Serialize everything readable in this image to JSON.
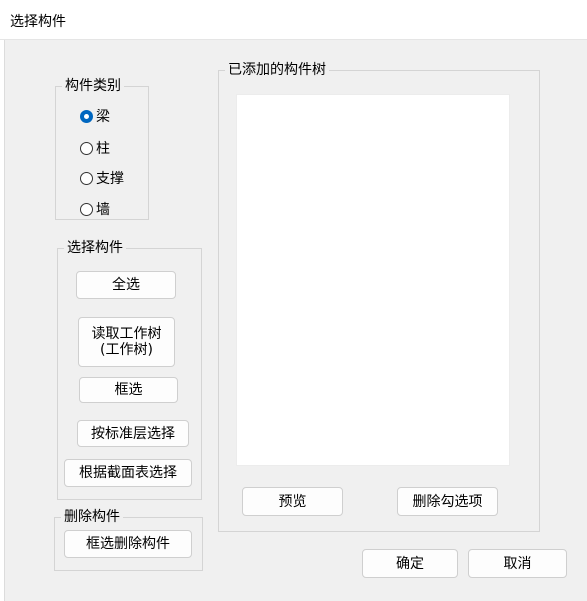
{
  "window": {
    "title": "选择构件"
  },
  "component_type_group": {
    "legend": "构件类别",
    "options": [
      {
        "label": "梁",
        "checked": true
      },
      {
        "label": "柱",
        "checked": false
      },
      {
        "label": "支撑",
        "checked": false
      },
      {
        "label": "墙",
        "checked": false
      }
    ]
  },
  "select_group": {
    "legend": "选择构件",
    "buttons": {
      "select_all": "全选",
      "read_tree_line1": "读取工作树",
      "read_tree_line2": "(工作树)",
      "box_select": "框选",
      "by_floor": "按标准层选择",
      "by_section": "根据截面表选择"
    }
  },
  "delete_group": {
    "legend": "删除构件",
    "box_delete": "框选删除构件"
  },
  "tree_group": {
    "legend": "已添加的构件树",
    "preview": "预览",
    "delete_checked": "删除勾选项"
  },
  "footer": {
    "ok": "确定",
    "cancel": "取消"
  },
  "colors": {
    "radio_checked": "#0067c0",
    "dialog_bg": "#f0f0f0"
  }
}
